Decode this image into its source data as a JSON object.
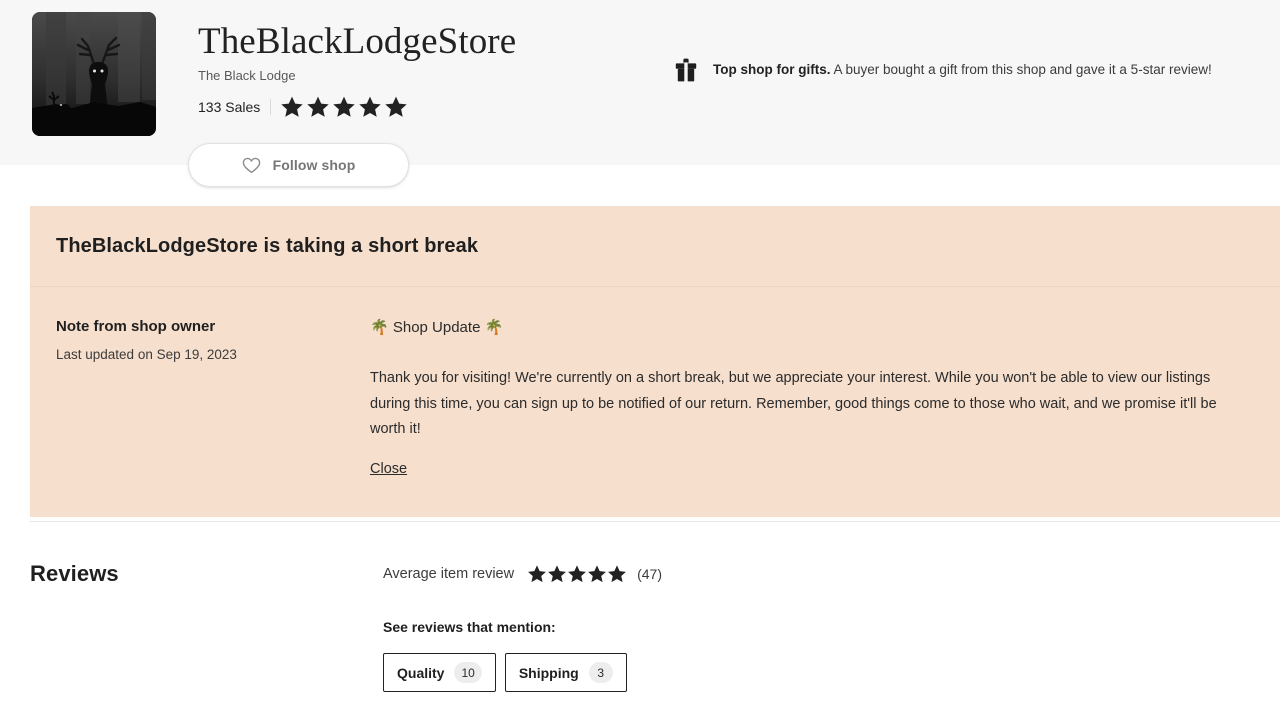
{
  "shop": {
    "name": "TheBlackLodgeStore",
    "subtitle": "The Black Lodge",
    "sales": "133 Sales",
    "star_rating": 5,
    "avatar_alt": "dark-forest-stag-avatar"
  },
  "badge": {
    "icon": "gift-icon",
    "headline": "Top shop for gifts.",
    "description": "A buyer bought a gift from this shop and gave it a 5-star review!"
  },
  "follow": {
    "icon": "heart-icon",
    "label": "Follow shop"
  },
  "vacation": {
    "heading": "TheBlackLodgeStore is taking a short break",
    "note_title": "Note from shop owner",
    "note_updated": "Last updated on Sep 19, 2023",
    "note_heading": "🌴 Shop Update 🌴",
    "note_body": "Thank you for visiting! We're currently on a short break, but we appreciate your interest. While you won't be able to view our listings during this time, you can sign up to be notified of our return. Remember, good things come to those who wait, and we promise it'll be worth it!",
    "close_label": "Close",
    "bg_color": "#f6dfcd"
  },
  "reviews": {
    "title": "Reviews",
    "average_label": "Average item review",
    "average_stars": 5,
    "count_label": "(47)",
    "mention_label": "See reviews that mention:",
    "mentions": [
      {
        "label": "Quality",
        "count": "10"
      },
      {
        "label": "Shipping",
        "count": "3"
      }
    ]
  }
}
